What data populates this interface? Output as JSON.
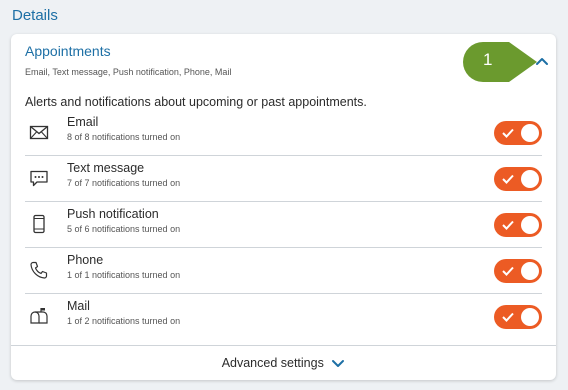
{
  "section": {
    "title": "Details"
  },
  "card": {
    "title": "Appointments",
    "subtitle": "Email, Text message, Push notification, Phone, Mail",
    "description": "Alerts and notifications about upcoming or past appointments.",
    "badge": "1",
    "accent_color": "#ec5b24",
    "link_color": "#1d6fa5",
    "badge_color": "#6b9a2e"
  },
  "rows": [
    {
      "icon": "envelope-icon",
      "label": "Email",
      "count": "8 of 8 notifications turned on",
      "enabled": true
    },
    {
      "icon": "chat-bubble-icon",
      "label": "Text message",
      "count": "7 of 7 notifications turned on",
      "enabled": true
    },
    {
      "icon": "mobile-phone-icon",
      "label": "Push notification",
      "count": "5 of 6 notifications turned on",
      "enabled": true
    },
    {
      "icon": "phone-handset-icon",
      "label": "Phone",
      "count": "1 of 1 notifications turned on",
      "enabled": true
    },
    {
      "icon": "mailbox-icon",
      "label": "Mail",
      "count": "1 of 2 notifications turned on",
      "enabled": true
    }
  ],
  "footer": {
    "advanced_label": "Advanced settings"
  }
}
